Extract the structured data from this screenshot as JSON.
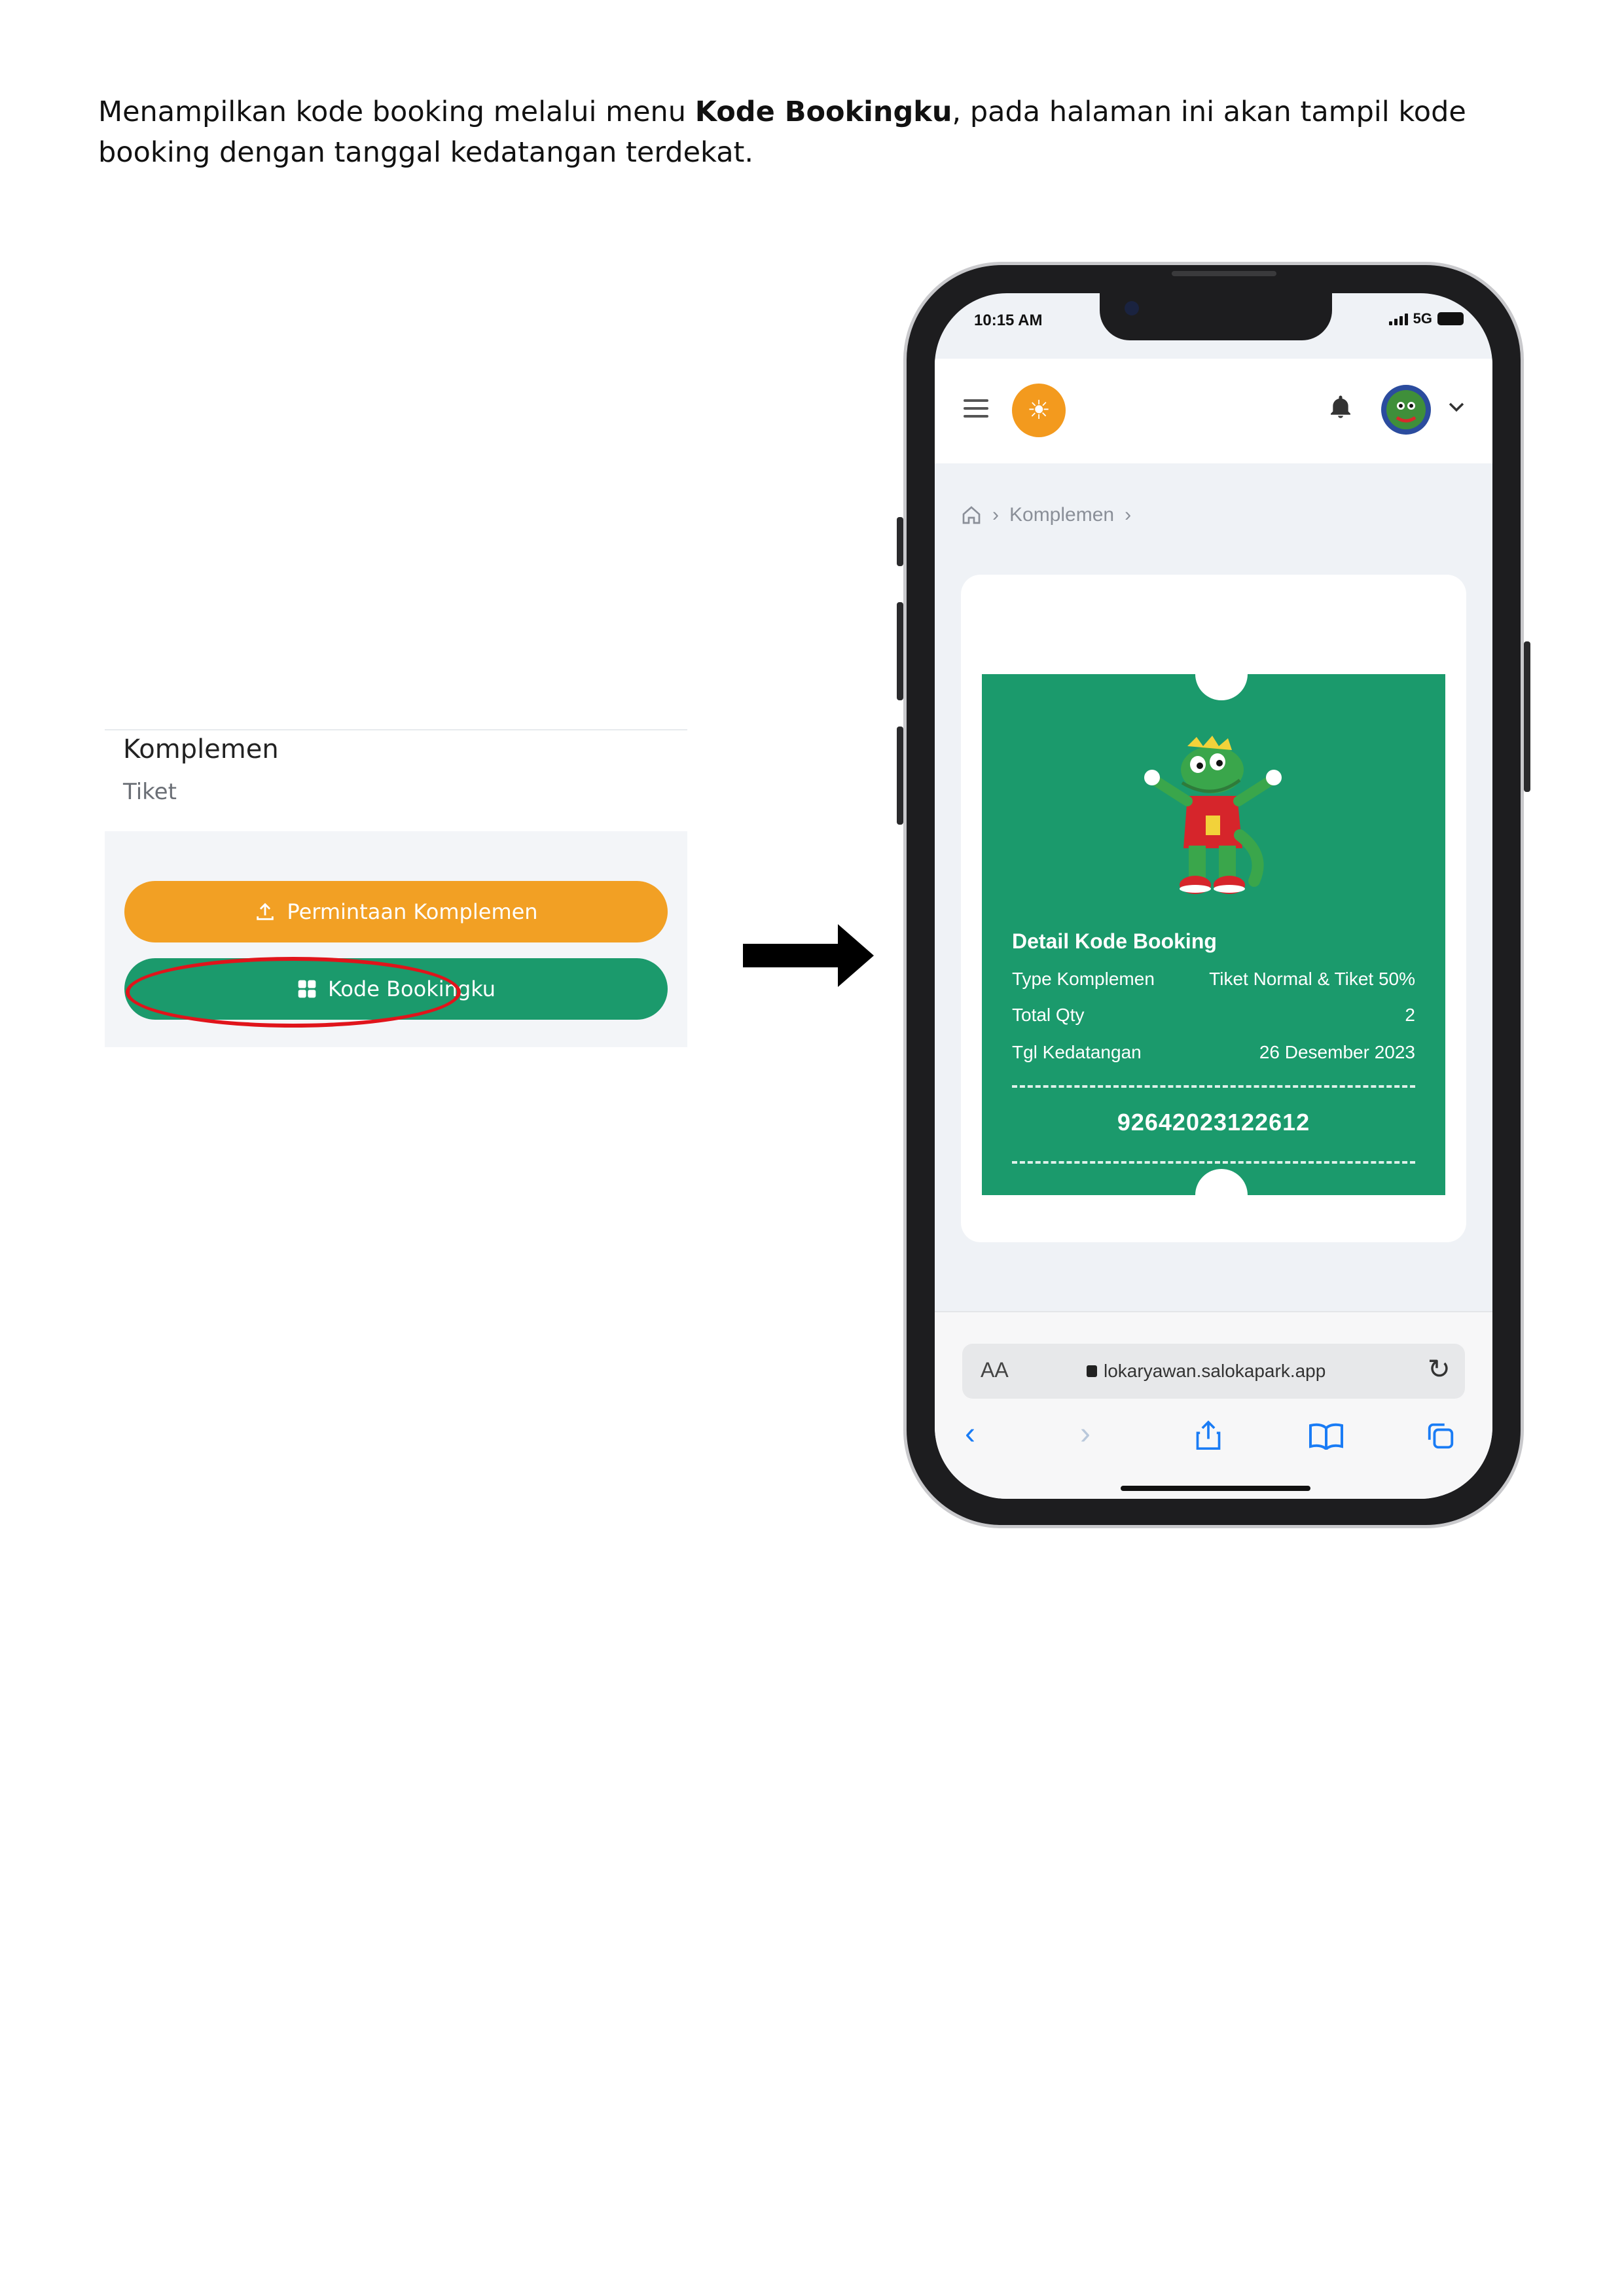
{
  "intro": {
    "before": "Menampilkan kode booking melalui menu ",
    "bold": "Kode Bookingku",
    "after": ", pada halaman ini akan tampil kode booking dengan tanggal kedatangan terdekat."
  },
  "left_panel": {
    "title": "Komplemen",
    "subtitle": "Tiket",
    "request_button": "Permintaan Komplemen",
    "booking_button": "Kode Bookingku"
  },
  "phone": {
    "status": {
      "time": "10:15 AM",
      "network": "5G"
    },
    "breadcrumb": {
      "current": "Komplemen"
    },
    "ticket": {
      "title": "Detail Kode Booking",
      "rows": [
        {
          "label": "Type Komplemen",
          "value": "Tiket Normal & Tiket 50%"
        },
        {
          "label": "Total Qty",
          "value": "2"
        },
        {
          "label": "Tgl Kedatangan",
          "value": "26 Desember 2023"
        }
      ],
      "code": "92642023122612"
    },
    "browser": {
      "aa": "AA",
      "url": "lokaryawan.salokapark.app"
    }
  },
  "colors": {
    "green": "#1b9a6c",
    "orange": "#f2a024",
    "highlight": "#e0141b",
    "ios_blue": "#1a7cf5"
  },
  "icons": [
    "upload-icon",
    "grid-icon",
    "arrow-right-icon",
    "menu-icon",
    "sun-logo-icon",
    "bell-icon",
    "avatar-icon",
    "chevron-down-icon",
    "home-icon",
    "chevron-right-icon",
    "lock-icon",
    "reload-icon",
    "back-icon",
    "forward-icon",
    "share-icon",
    "bookmarks-icon",
    "tabs-icon"
  ]
}
